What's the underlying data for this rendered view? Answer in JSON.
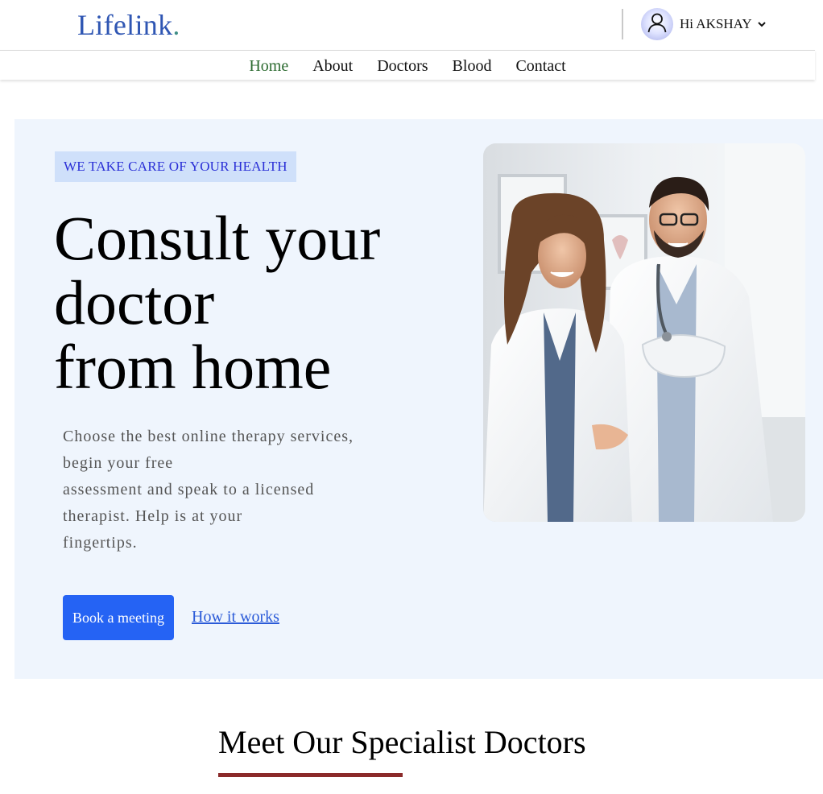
{
  "brand": {
    "name": "Lifelink",
    "dot": "."
  },
  "user": {
    "greeting": "Hi AKSHAY",
    "avatar_icon": "user-icon",
    "menu_icon": "chevron-down-icon"
  },
  "nav": {
    "items": [
      {
        "label": "Home",
        "active": true
      },
      {
        "label": "About",
        "active": false
      },
      {
        "label": "Doctors",
        "active": false
      },
      {
        "label": "Blood",
        "active": false
      },
      {
        "label": "Contact",
        "active": false
      }
    ]
  },
  "hero": {
    "tagline": "WE TAKE CARE OF YOUR HEALTH",
    "headline_line1": "Consult your",
    "headline_line2": "doctor",
    "headline_line3": "from home",
    "sub_line1": "Choose the best online therapy services,",
    "sub_line2": "begin your free",
    "sub_line3": "assessment and speak to a licensed",
    "sub_line4": "therapist. Help is at your",
    "sub_line5": "fingertips.",
    "cta_primary": "Book a meeting",
    "cta_secondary": "How it works",
    "image_alt": "doctors-photo"
  },
  "section": {
    "title": "Meet Our Specialist Doctors"
  },
  "colors": {
    "brand": "#2f56b3",
    "nav_active": "#2b6a2f",
    "hero_bg": "#eff5fd",
    "tagline_bg": "#cfe0fa",
    "tagline_text": "#2a2fd6",
    "primary_button": "#2563f4",
    "link": "#2a5ad8",
    "section_underline": "#8b2a2a"
  }
}
